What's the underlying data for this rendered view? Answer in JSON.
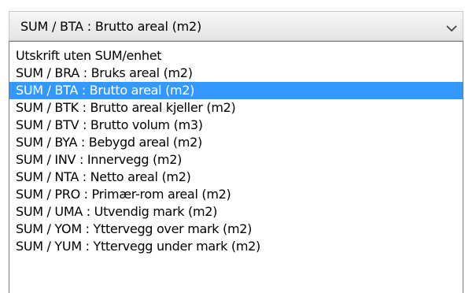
{
  "select": {
    "current_value": "SUM / BTA : Brutto areal (m2)",
    "arrow_icon": "chevron-down-icon",
    "selected_index": 2,
    "selection_color": "#3399ff",
    "options": [
      "Utskrift uten SUM/enhet",
      "SUM / BRA : Bruks areal (m2)",
      "SUM / BTA : Brutto areal (m2)",
      "SUM / BTK : Brutto areal kjeller (m2)",
      "SUM / BTV : Brutto volum (m3)",
      "SUM / BYA : Bebygd areal (m2)",
      "SUM / INV : Innervegg (m2)",
      "SUM / NTA : Netto areal (m2)",
      "SUM / PRO : Primær-rom areal (m2)",
      "SUM / UMA : Utvendig mark (m2)",
      "SUM / YOM : Yttervegg over mark (m2)",
      "SUM / YUM : Yttervegg under mark (m2)"
    ]
  }
}
